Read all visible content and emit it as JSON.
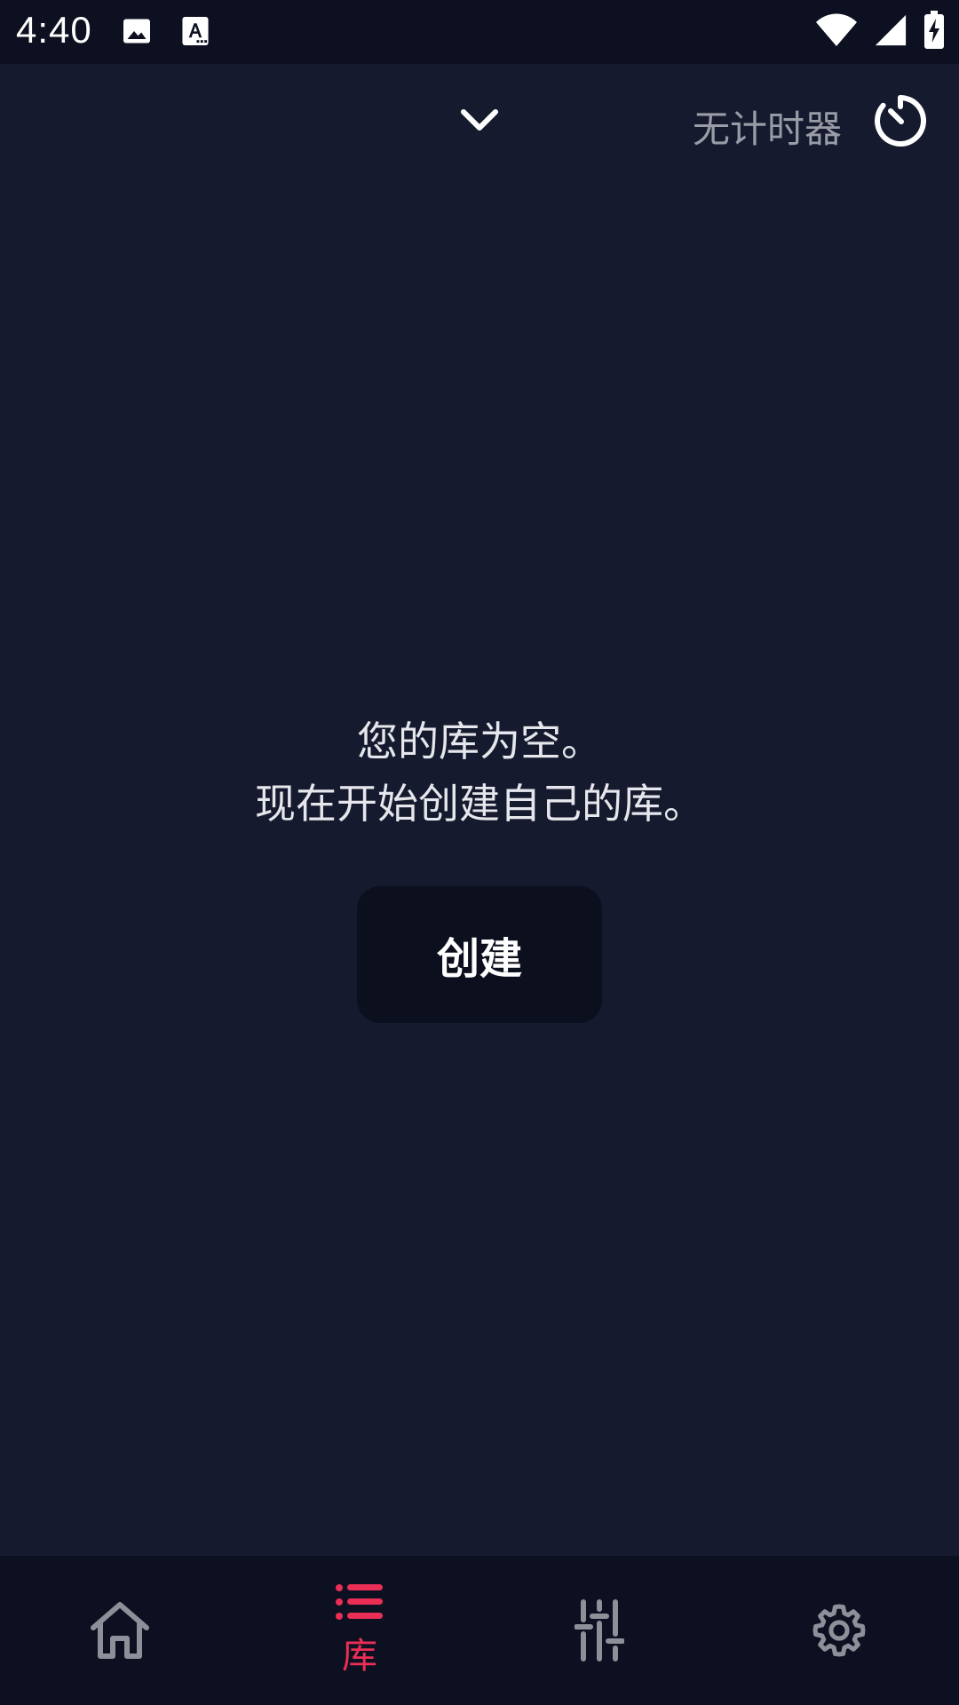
{
  "status_bar": {
    "time": "4:40"
  },
  "top_bar": {
    "timer_label": "无计时器"
  },
  "empty_state": {
    "line1": "您的库为空。",
    "line2": "现在开始创建自己的库。",
    "create_button": "创建"
  },
  "bottom_nav": {
    "items": [
      {
        "icon": "home-icon",
        "label": ""
      },
      {
        "icon": "list-icon",
        "label": "库",
        "active": true
      },
      {
        "icon": "equalizer-icon",
        "label": ""
      },
      {
        "icon": "gear-icon",
        "label": ""
      }
    ]
  },
  "colors": {
    "background": "#151a2e",
    "bar_background": "#0d1020",
    "accent": "#ea2e55",
    "inactive_icon": "#8d8f99",
    "button_background": "#0c0f1d"
  }
}
